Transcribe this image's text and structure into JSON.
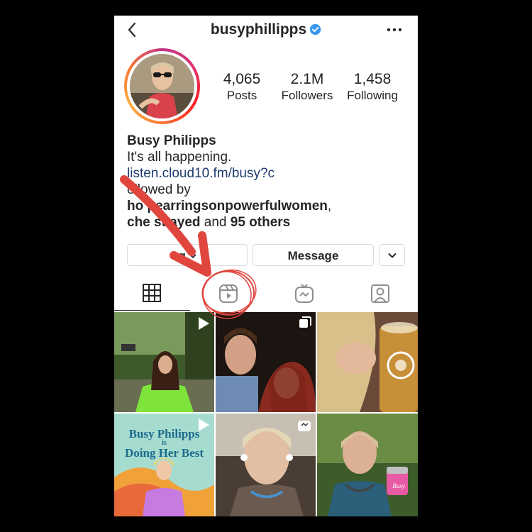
{
  "profile": {
    "username": "busyphillipps",
    "verified": true,
    "display_name": "Busy Philipps",
    "bio_line": "It's all happening.",
    "link": "listen.cloud10.fm/busy?c",
    "followed_by_prefix": "ollowed by",
    "followed_by_user1": "ho    pearringsonpowerfulwomen",
    "followed_by_user2": "che    st   ayed",
    "followed_by_and": " and ",
    "followed_by_others": "95 others"
  },
  "stats": [
    {
      "value": "4,065",
      "label": "Posts"
    },
    {
      "value": "2.1M",
      "label": "Followers"
    },
    {
      "value": "1,458",
      "label": "Following"
    }
  ],
  "buttons": {
    "following_label": "          g",
    "message_label": "Message"
  },
  "tabs": [
    "grid",
    "reels",
    "igtv",
    "tagged"
  ],
  "grid_tiles": [
    {
      "type": "video"
    },
    {
      "type": "carousel"
    },
    {
      "type": "photo"
    },
    {
      "type": "video",
      "text_line1": "Busy Philipps",
      "text_line2": "is",
      "text_line3": "Doing Her Best"
    },
    {
      "type": "igtv"
    },
    {
      "type": "photo",
      "cup_text": "Busy"
    }
  ],
  "colors": {
    "link": "#1f3b70",
    "verified": "#3897f0",
    "annotation": "#e0453e"
  }
}
